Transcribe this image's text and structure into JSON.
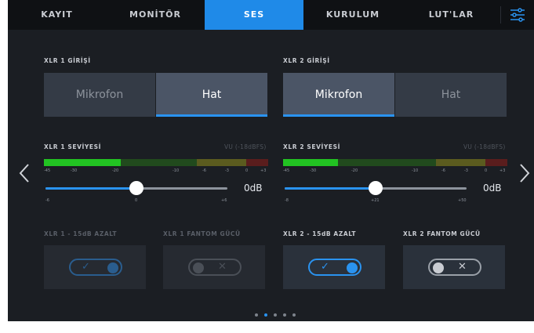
{
  "tabs": [
    {
      "label": "KAYIT",
      "active": false
    },
    {
      "label": "MONİTÖR",
      "active": false
    },
    {
      "label": "SES",
      "active": true
    },
    {
      "label": "KURULUM",
      "active": false
    },
    {
      "label": "LUT'LAR",
      "active": false
    }
  ],
  "settings_icon": "sliders-icon",
  "xlr1": {
    "input_label": "XLR 1 GİRİŞİ",
    "options": [
      "Mikrofon",
      "Hat"
    ],
    "selected": "Hat",
    "level_label": "XLR 1 SEVİYESİ",
    "vu_label": "VU (-18dBFS)",
    "meter_scale": [
      "-45",
      "-30",
      "-20",
      "-10",
      "-6",
      "-3",
      "0",
      "+3"
    ],
    "level_value": "0dB",
    "level_fraction": 0.5,
    "slider_ticks": [
      "-6",
      "0",
      "+6"
    ],
    "attenuate_label": "XLR 1 - 15dB AZALT",
    "attenuate_on": true,
    "attenuate_enabled": false,
    "phantom_label": "XLR 1 FANTOM GÜCÜ",
    "phantom_on": false,
    "phantom_enabled": false
  },
  "xlr2": {
    "input_label": "XLR 2 GİRİŞİ",
    "options": [
      "Mikrofon",
      "Hat"
    ],
    "selected": "Mikrofon",
    "level_label": "XLR 2 SEVİYESİ",
    "vu_label": "VU (-18dBFS)",
    "meter_scale": [
      "-45",
      "-30",
      "-20",
      "-10",
      "-6",
      "-3",
      "0",
      "+3"
    ],
    "level_value": "0dB",
    "level_fraction": 0.5,
    "slider_ticks": [
      "-8",
      "+21",
      "+50"
    ],
    "attenuate_label": "XLR 2 - 15dB AZALT",
    "attenuate_on": true,
    "attenuate_enabled": true,
    "phantom_label": "XLR 2 FANTOM GÜCÜ",
    "phantom_on": false,
    "phantom_enabled": true
  },
  "page_indicator": {
    "count": 5,
    "active": 1
  },
  "colors": {
    "accent": "#2a93f0",
    "meter_green": "#22c322",
    "meter_olive": "#5b5b1f",
    "meter_red": "#5a1d1d",
    "tab_active": "#1f8ae8"
  }
}
